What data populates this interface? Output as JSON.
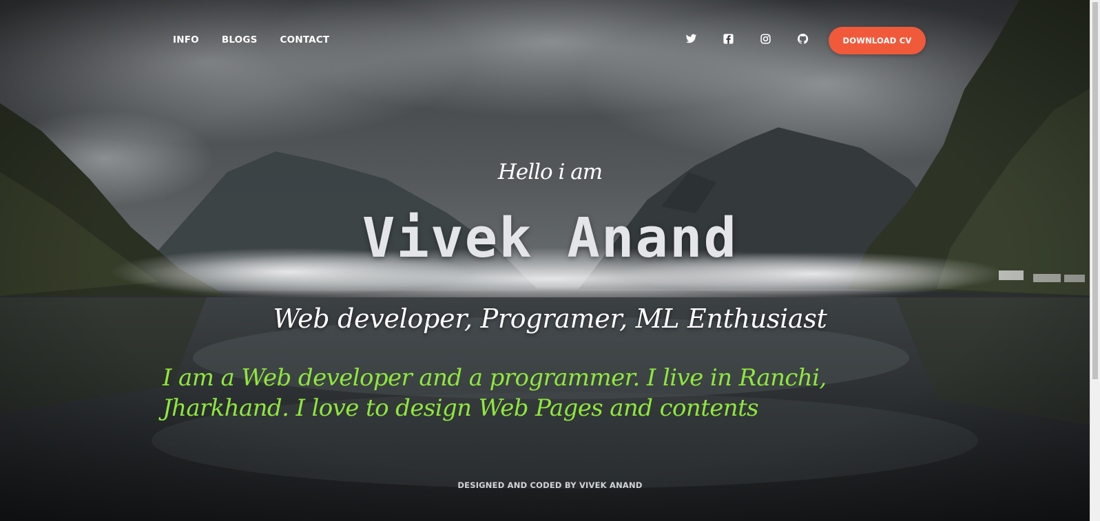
{
  "nav": {
    "links": [
      "INFO",
      "BLOGS",
      "CONTACT"
    ],
    "social_icons": [
      "twitter-icon",
      "facebook-icon",
      "instagram-icon",
      "github-icon"
    ],
    "cv_button": "DOWNLOAD CV"
  },
  "hero": {
    "greeting": "Hello i am",
    "name": "Vivek Anand",
    "roles": "Web developer, Programer, ML Enthusiast",
    "bio": "I am a Web developer and a programmer. I live in Ranchi, Jharkhand. I love to design Web Pages and contents"
  },
  "footer": {
    "credit": "DESIGNED AND CODED BY VIVEK ANAND"
  },
  "colors": {
    "accent_button": "#f05a3b",
    "bio_text": "#8ee83b",
    "background": "#2a2d30"
  }
}
